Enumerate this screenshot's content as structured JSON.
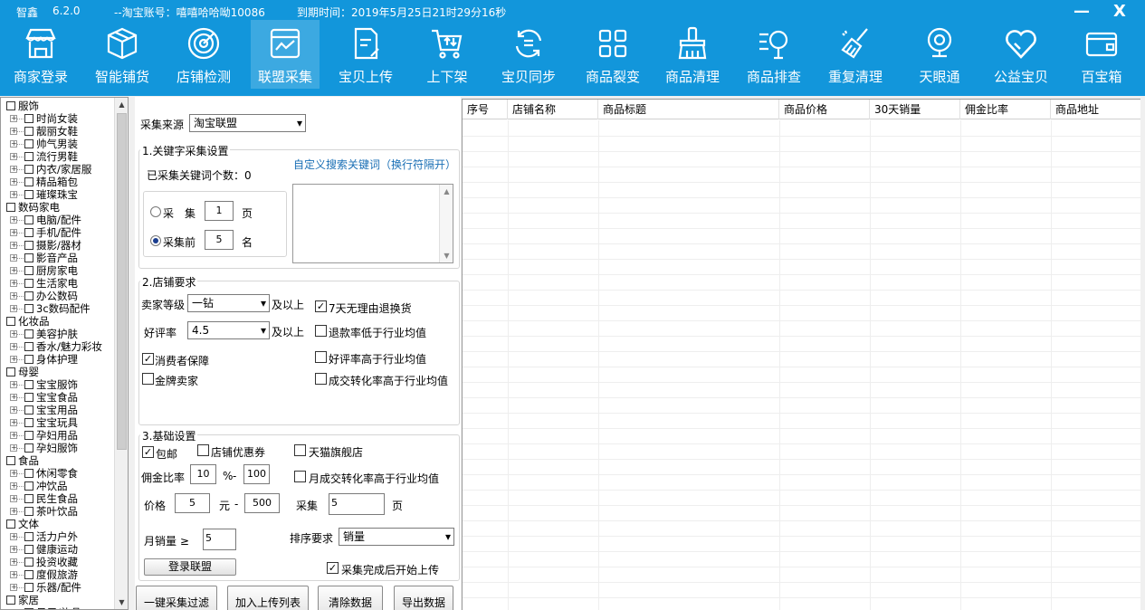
{
  "titlebar": {
    "app_name": "智鑫",
    "version": "6.2.0",
    "account": "--淘宝账号：嘻嘻哈哈呦10086",
    "expiry": "到期时间：2019年5月25日21时29分16秒",
    "minimize": "—",
    "close": "X"
  },
  "toolbar": [
    {
      "label": "商家登录",
      "icon": "store-icon"
    },
    {
      "label": "智能铺货",
      "icon": "box-icon"
    },
    {
      "label": "店铺检测",
      "icon": "radar-icon"
    },
    {
      "label": "联盟采集",
      "icon": "chart-board-icon"
    },
    {
      "label": "宝贝上传",
      "icon": "upload-doc-icon"
    },
    {
      "label": "上下架",
      "icon": "cart-icon"
    },
    {
      "label": "宝贝同步",
      "icon": "sync-icon"
    },
    {
      "label": "商品裂变",
      "icon": "grid-icon"
    },
    {
      "label": "商品清理",
      "icon": "broom-icon"
    },
    {
      "label": "商品排查",
      "icon": "search-list-icon"
    },
    {
      "label": "重复清理",
      "icon": "sweep-icon"
    },
    {
      "label": "天眼通",
      "icon": "camera-icon"
    },
    {
      "label": "公益宝贝",
      "icon": "heart-icon"
    },
    {
      "label": "百宝箱",
      "icon": "wallet-icon"
    }
  ],
  "tree": [
    {
      "label": "服饰",
      "level": 0
    },
    {
      "label": "时尚女装",
      "level": 1
    },
    {
      "label": "靓丽女鞋",
      "level": 1
    },
    {
      "label": "帅气男装",
      "level": 1
    },
    {
      "label": "流行男鞋",
      "level": 1
    },
    {
      "label": "内衣/家居服",
      "level": 1
    },
    {
      "label": "精品箱包",
      "level": 1
    },
    {
      "label": "璀璨珠宝",
      "level": 1
    },
    {
      "label": "数码家电",
      "level": 0
    },
    {
      "label": "电脑/配件",
      "level": 1
    },
    {
      "label": "手机/配件",
      "level": 1
    },
    {
      "label": "摄影/器材",
      "level": 1
    },
    {
      "label": "影音产品",
      "level": 1
    },
    {
      "label": "厨房家电",
      "level": 1
    },
    {
      "label": "生活家电",
      "level": 1
    },
    {
      "label": "办公数码",
      "level": 1
    },
    {
      "label": "3c数码配件",
      "level": 1
    },
    {
      "label": "化妆品",
      "level": 0
    },
    {
      "label": "美容护肤",
      "level": 1
    },
    {
      "label": "香水/魅力彩妆",
      "level": 1
    },
    {
      "label": "身体护理",
      "level": 1
    },
    {
      "label": "母婴",
      "level": 0
    },
    {
      "label": "宝宝服饰",
      "level": 1
    },
    {
      "label": "宝宝食品",
      "level": 1
    },
    {
      "label": "宝宝用品",
      "level": 1
    },
    {
      "label": "宝宝玩具",
      "level": 1
    },
    {
      "label": "孕妇用品",
      "level": 1
    },
    {
      "label": "孕妇服饰",
      "level": 1
    },
    {
      "label": "食品",
      "level": 0
    },
    {
      "label": "休闲零食",
      "level": 1
    },
    {
      "label": "冲饮品",
      "level": 1
    },
    {
      "label": "民生食品",
      "level": 1
    },
    {
      "label": "茶叶饮品",
      "level": 1
    },
    {
      "label": "文体",
      "level": 0
    },
    {
      "label": "活力户外",
      "level": 1
    },
    {
      "label": "健康运动",
      "level": 1
    },
    {
      "label": "投资收藏",
      "level": 1
    },
    {
      "label": "度假旅游",
      "level": 1
    },
    {
      "label": "乐器/配件",
      "level": 1
    },
    {
      "label": "家居",
      "level": 0
    },
    {
      "label": "日用/礼品",
      "level": 1
    }
  ],
  "source": {
    "label": "采集来源",
    "value": "淘宝联盟"
  },
  "keyword": {
    "group_title": "1.关键字采集设置",
    "count_label": "已采集关键词个数：0",
    "custom_link": "自定义搜索关键词（换行符隔开）",
    "radio1_label": "采　集",
    "radio1_value": "1",
    "radio1_unit": "页",
    "radio2_label": "采集前",
    "radio2_value": "5",
    "radio2_unit": "名"
  },
  "shop": {
    "group_title": "2.店铺要求",
    "seller_level_label": "卖家等级",
    "seller_level_value": "一钻",
    "seller_level_suffix": "及以上",
    "rating_label": "好评率",
    "rating_value": "4.5",
    "rating_suffix": "及以上",
    "consumer_label": "消费者保障",
    "gold_label": "金牌卖家",
    "seven_day_label": "7天无理由退换货",
    "refund_label": "退款率低于行业均值",
    "good_rate_label": "好评率高于行业均值",
    "conversion_label": "成交转化率高于行业均值"
  },
  "basic": {
    "group_title": "3.基础设置",
    "free_ship_label": "包邮",
    "coupon_label": "店铺优惠券",
    "tmall_label": "天猫旗舰店",
    "commission_label": "佣金比率",
    "commission_min": "10",
    "percent": "%",
    "dash": "-",
    "commission_max": "100",
    "monthly_conv_label": "月成交转化率高于行业均值",
    "price_label": "价格",
    "price_min": "5",
    "yuan": "元",
    "price_max": "500",
    "collect_label": "采集",
    "collect_value": "5",
    "collect_unit": "页",
    "monthly_sales_label": "月销量 ≥",
    "monthly_sales_value": "5",
    "sort_label": "排序要求",
    "sort_value": "销量",
    "login_button": "登录联盟",
    "auto_upload_label": "采集完成后开始上传"
  },
  "actions": {
    "filter": "一键采集过滤",
    "add_upload": "加入上传列表",
    "clear": "清除数据",
    "export": "导出数据"
  },
  "table": {
    "columns": [
      "序号",
      "店铺名称",
      "商品标题",
      "商品价格",
      "30天销量",
      "佣金比率",
      "商品地址"
    ]
  },
  "colors": {
    "header_bg": "#1296db",
    "link": "#1a6fb5"
  }
}
